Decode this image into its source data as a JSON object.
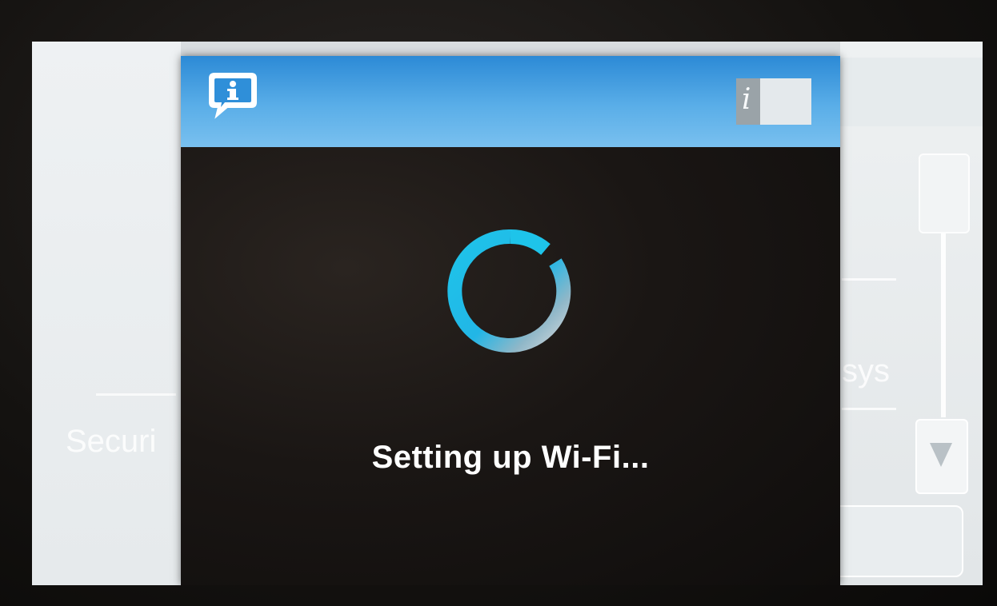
{
  "background": {
    "left_panel_text": "Securi",
    "right_panel_text": "sys"
  },
  "dialog": {
    "header_left_icon": "info-speech-bubble-icon",
    "header_right_icon": "info-toggle-icon",
    "header_right_glyph": "i",
    "header_color": "#4ba3e3",
    "spinner_icon": "loading-spinner-icon",
    "spinner_color": "#1ec4ea",
    "message": "Setting up Wi-Fi..."
  },
  "scrollbar": {
    "up_icon": "scroll-up-icon",
    "down_icon": "scroll-down-icon"
  }
}
